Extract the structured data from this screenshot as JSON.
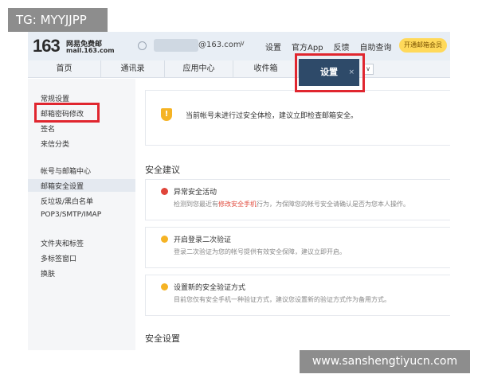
{
  "overlay": {
    "tg_label": "TG: MYYJJPP",
    "watermark": "www.sanshengtiyucn.com"
  },
  "header": {
    "logo_number": "163",
    "logo_cn": "网易免费邮",
    "logo_domain": "mail.163.com",
    "account_domain": "@163.com",
    "account_caret": "∨",
    "links": [
      "设置",
      "官方App",
      "反馈",
      "自助查询"
    ],
    "vip_button": "开通邮箱会员"
  },
  "nav": {
    "tabs": [
      "首页",
      "通讯录",
      "应用中心",
      "收件箱"
    ],
    "active_tab": "设置",
    "active_close": "×",
    "more_caret": "∨"
  },
  "sidebar": {
    "items": [
      "常规设置",
      "邮箱密码修改",
      "签名",
      "来信分类",
      "帐号与邮箱中心",
      "邮箱安全设置",
      "反垃圾/黑白名单",
      "POP3/SMTP/IMAP",
      "文件夹和标签",
      "多标签窗口",
      "换肤"
    ],
    "selected_index": 5
  },
  "main": {
    "notice_icon": "!",
    "notice_text": "当前帐号未进行过安全体检，建议立即检查邮箱安全。",
    "section_recommend": "安全建议",
    "recommendations": [
      {
        "icon": "red-alert",
        "icon_color": "#e0453a",
        "title": "异常安全活动",
        "desc_pre": "检测到您最近有",
        "desc_link": "修改安全手机",
        "desc_post": "行为，为保障您的帐号安全请确认是否为您本人操作。"
      },
      {
        "icon": "warning",
        "icon_color": "#f5b324",
        "title": "开启登录二次验证",
        "desc_pre": "登录二次验证为您的帐号提供有效安全保障，建议立即开启。",
        "desc_link": "",
        "desc_post": ""
      },
      {
        "icon": "warning",
        "icon_color": "#f5b324",
        "title": "设置新的安全验证方式",
        "desc_pre": "目前您仅有安全手机一种验证方式，建议您设置新的验证方式作为备用方式。",
        "desc_link": "",
        "desc_post": ""
      }
    ],
    "section_settings": "安全设置"
  },
  "colors": {
    "accent_dark": "#2e4a69",
    "highlight_red": "#e0262f",
    "link_red": "#e04a3c",
    "warning_yellow": "#f5b324"
  }
}
